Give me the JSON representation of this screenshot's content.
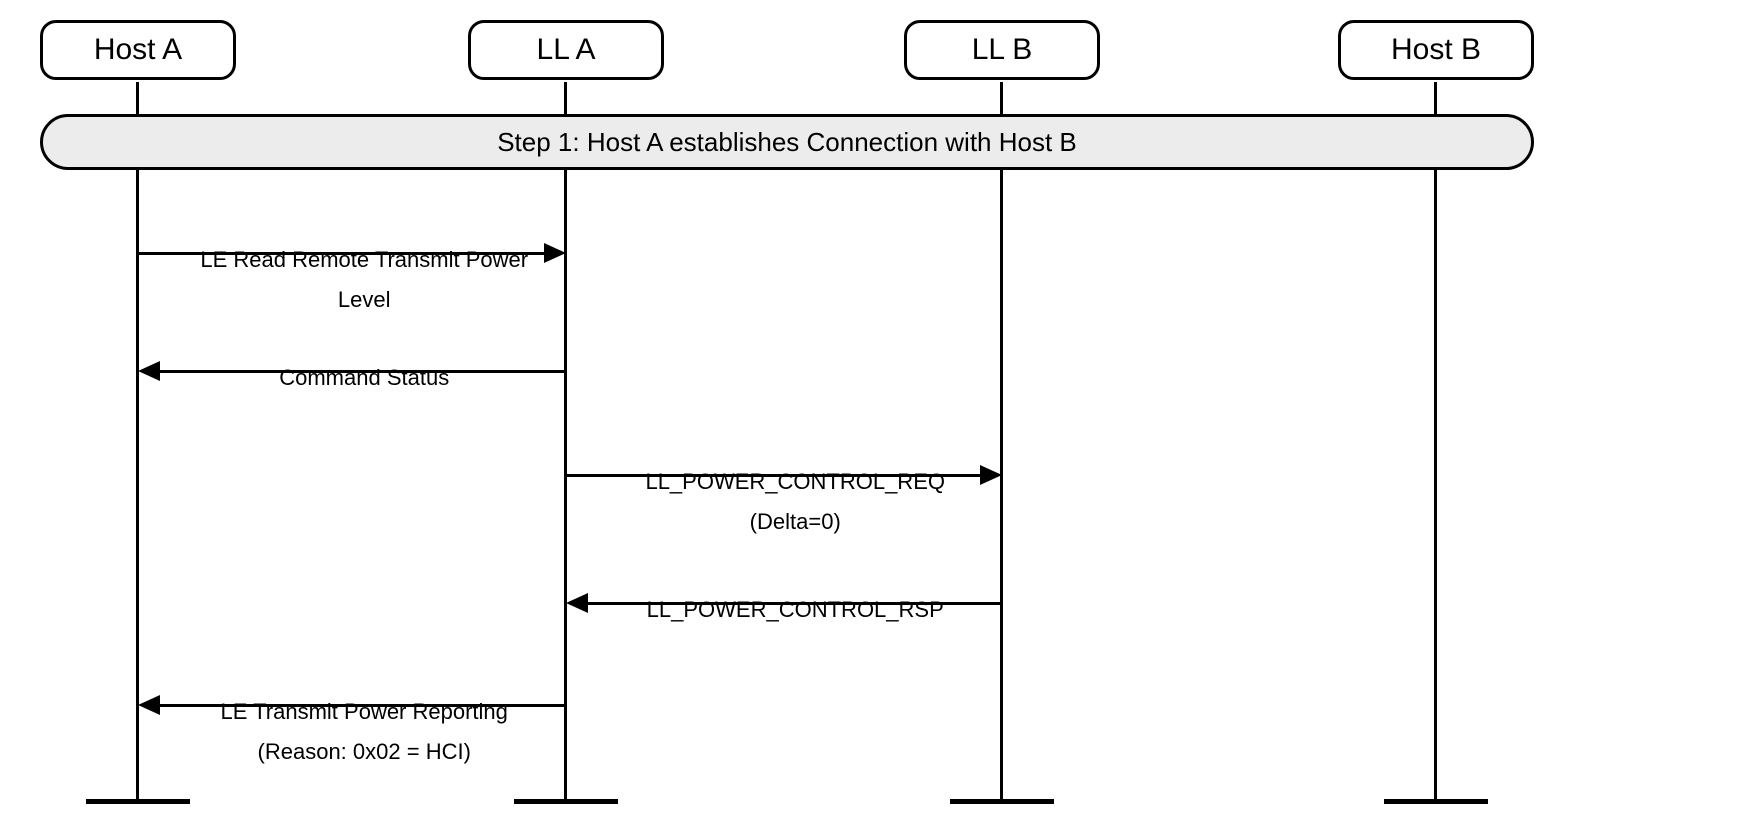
{
  "participants": {
    "host_a": "Host A",
    "ll_a": "LL A",
    "ll_b": "LL B",
    "host_b": "Host B"
  },
  "step_bar": "Step 1:  Host A establishes Connection with Host B",
  "messages": {
    "m1": {
      "from": "host_a",
      "to": "ll_a",
      "dir": "right",
      "line1": "LE Read Remote Transmit Power",
      "line2": "Level"
    },
    "m2": {
      "from": "ll_a",
      "to": "host_a",
      "dir": "left",
      "line1": "Command Status"
    },
    "m3": {
      "from": "ll_a",
      "to": "ll_b",
      "dir": "right",
      "line1": "LL_POWER_CONTROL_REQ",
      "line2": "(Delta=0)"
    },
    "m4": {
      "from": "ll_b",
      "to": "ll_a",
      "dir": "left",
      "line1": "LL_POWER_CONTROL_RSP"
    },
    "m5": {
      "from": "ll_a",
      "to": "host_a",
      "dir": "left",
      "line1": "LE Transmit Power Reporting",
      "line2": "(Reason: 0x02 = HCI)"
    }
  }
}
